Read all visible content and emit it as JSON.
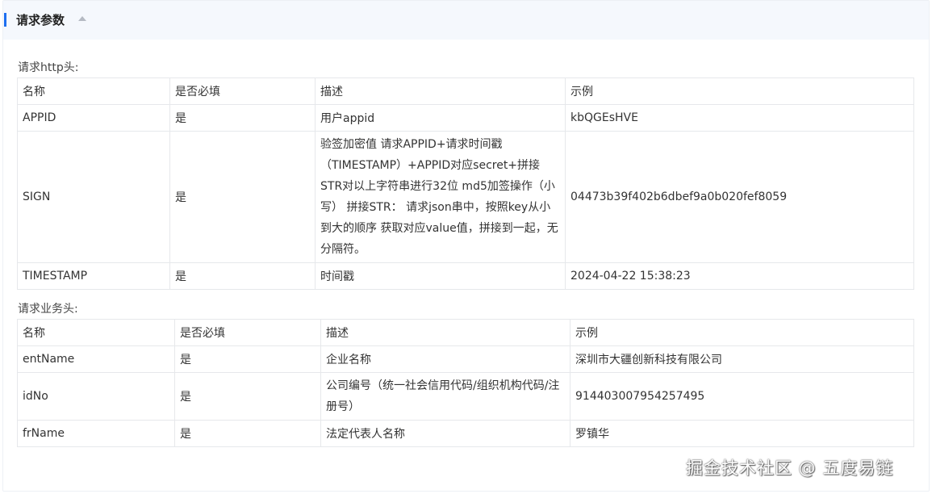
{
  "header": {
    "title": "请求参数"
  },
  "http_section": {
    "label": "请求http头:",
    "columns": [
      "名称",
      "是否必填",
      "描述",
      "示例"
    ],
    "rows": [
      [
        "APPID",
        "是",
        "用户appid",
        "kbQGEsHVE"
      ],
      [
        "SIGN",
        "是",
        "验签加密值 请求APPID+请求时间戳（TIMESTAMP）+APPID对应secret+拼接STR对以上字符串进行32位 md5加签操作（小写） 拼接STR： 请求json串中，按照key从小到大的顺序 获取对应value值，拼接到一起，无分隔符。",
        "04473b39f402b6dbef9a0b020fef8059"
      ],
      [
        "TIMESTAMP",
        "是",
        "时间戳",
        "2024-04-22 15:38:23"
      ]
    ]
  },
  "biz_section": {
    "label": "请求业务头:",
    "columns": [
      "名称",
      "是否必填",
      "描述",
      "示例"
    ],
    "rows": [
      [
        "entName",
        "是",
        "企业名称",
        "深圳市大疆创新科技有限公司"
      ],
      [
        "idNo",
        "是",
        "公司编号（统一社会信用代码/组织机构代码/注册号）",
        "914403007954257495"
      ],
      [
        "frName",
        "是",
        "法定代表人名称",
        "罗镇华"
      ]
    ]
  },
  "watermark": "掘金技术社区 @ 五度易链",
  "colors": {
    "accent": "#1e6ff0",
    "header_bg": "#f5f8fd",
    "border": "#e6e8eb"
  }
}
